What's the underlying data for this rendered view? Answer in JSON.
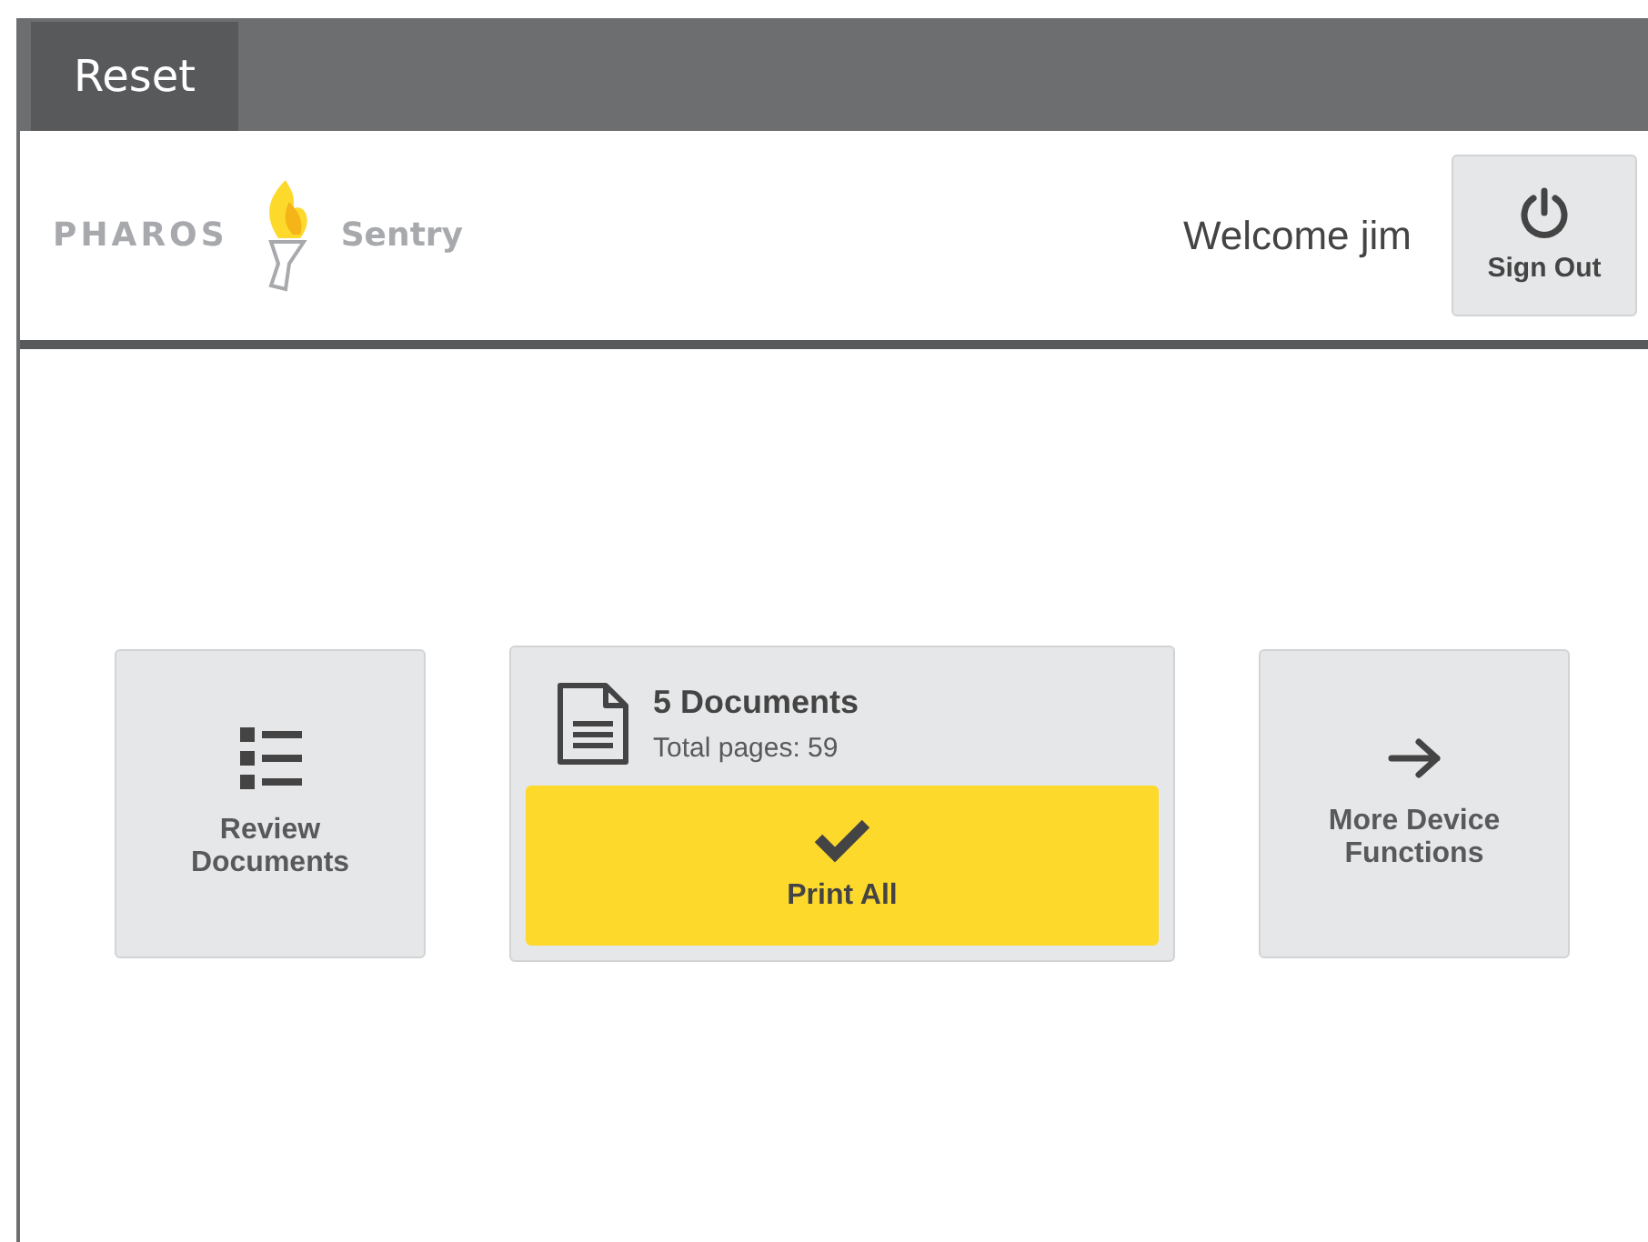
{
  "top_bar": {
    "reset_button": "Reset"
  },
  "header": {
    "logo": {
      "brand": "PHAROS",
      "product": "Sentry"
    },
    "welcome": "Welcome jim",
    "sign_out": "Sign Out"
  },
  "tiles": [
    {
      "kind": "review",
      "label": "Review Documents"
    },
    {
      "kind": "print",
      "title": "5 Documents",
      "subtitle": "Total pages: 59",
      "action": "Print All"
    },
    {
      "kind": "more",
      "label": "More Device Functions"
    }
  ]
}
